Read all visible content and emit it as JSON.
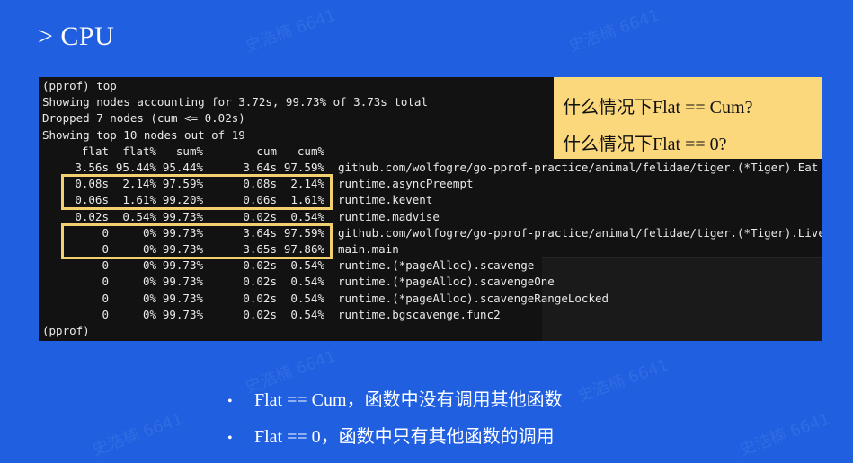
{
  "slide": {
    "title": "> CPU",
    "watermark": "史浩楠 6641"
  },
  "terminal": {
    "header_lines": [
      "(pprof) top",
      "Showing nodes accounting for 3.72s, 99.73% of 3.73s total",
      "Dropped 7 nodes (cum <= 0.02s)",
      "Showing top 10 nodes out of 19"
    ],
    "columns": [
      "flat",
      "flat%",
      "sum%",
      "cum",
      "cum%"
    ],
    "rows": [
      {
        "flat": "3.56s",
        "flat_pct": "95.44%",
        "sum_pct": "95.44%",
        "cum": "3.64s",
        "cum_pct": "97.59%",
        "name": "github.com/wolfogre/go-pprof-practice/animal/felidae/tiger.(*Tiger).Eat"
      },
      {
        "flat": "0.08s",
        "flat_pct": "2.14%",
        "sum_pct": "97.59%",
        "cum": "0.08s",
        "cum_pct": "2.14%",
        "name": "runtime.asyncPreempt"
      },
      {
        "flat": "0.06s",
        "flat_pct": "1.61%",
        "sum_pct": "99.20%",
        "cum": "0.06s",
        "cum_pct": "1.61%",
        "name": "runtime.kevent"
      },
      {
        "flat": "0.02s",
        "flat_pct": "0.54%",
        "sum_pct": "99.73%",
        "cum": "0.02s",
        "cum_pct": "0.54%",
        "name": "runtime.madvise"
      },
      {
        "flat": "0",
        "flat_pct": "0%",
        "sum_pct": "99.73%",
        "cum": "3.64s",
        "cum_pct": "97.59%",
        "name": "github.com/wolfogre/go-pprof-practice/animal/felidae/tiger.(*Tiger).Live"
      },
      {
        "flat": "0",
        "flat_pct": "0%",
        "sum_pct": "99.73%",
        "cum": "3.65s",
        "cum_pct": "97.86%",
        "name": "main.main"
      },
      {
        "flat": "0",
        "flat_pct": "0%",
        "sum_pct": "99.73%",
        "cum": "0.02s",
        "cum_pct": "0.54%",
        "name": "runtime.(*pageAlloc).scavenge"
      },
      {
        "flat": "0",
        "flat_pct": "0%",
        "sum_pct": "99.73%",
        "cum": "0.02s",
        "cum_pct": "0.54%",
        "name": "runtime.(*pageAlloc).scavengeOne"
      },
      {
        "flat": "0",
        "flat_pct": "0%",
        "sum_pct": "99.73%",
        "cum": "0.02s",
        "cum_pct": "0.54%",
        "name": "runtime.(*pageAlloc).scavengeRangeLocked"
      },
      {
        "flat": "0",
        "flat_pct": "0%",
        "sum_pct": "99.73%",
        "cum": "0.02s",
        "cum_pct": "0.54%",
        "name": "runtime.bgscavenge.func2"
      }
    ],
    "prompt": "(pprof)"
  },
  "callout": {
    "line1": "什么情况下Flat == Cum?",
    "line2": "什么情况下Flat == 0?"
  },
  "bullets": [
    "Flat == Cum，函数中没有调用其他函数",
    "Flat == 0，函数中只有其他函数的调用"
  ],
  "colors": {
    "background": "#1f5fe0",
    "terminal_bg": "#121212",
    "highlight": "#f2d070",
    "callout_bg": "#fbd87b"
  }
}
